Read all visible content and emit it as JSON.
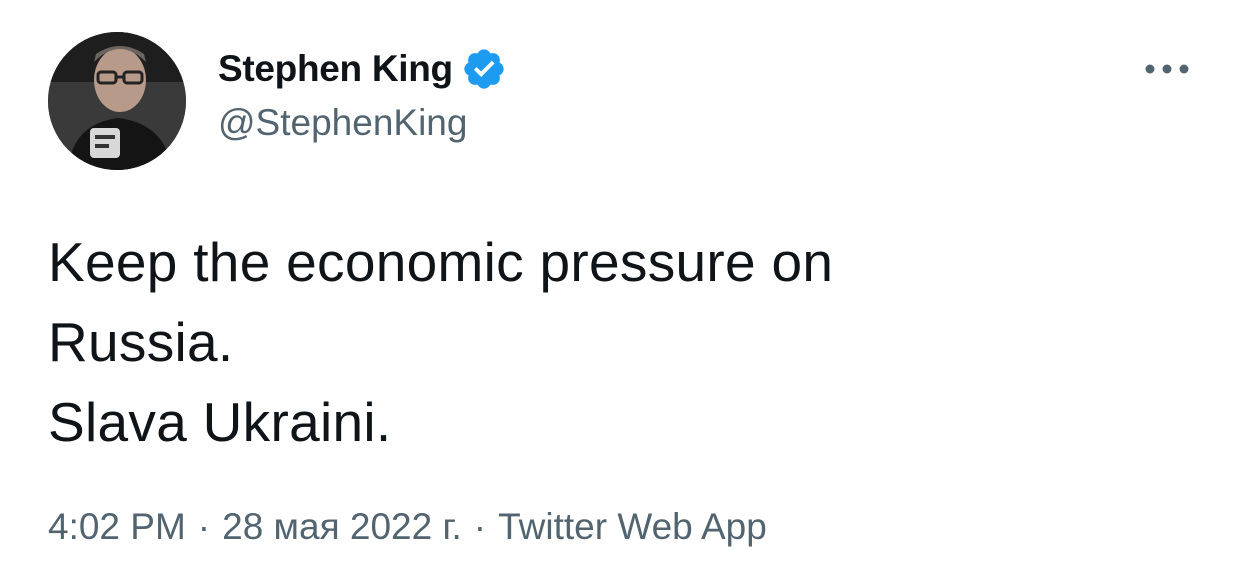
{
  "author": {
    "display_name": "Stephen King",
    "handle": "@StephenKing",
    "verified": true,
    "avatar_icon": "profile-photo",
    "verified_icon": "verified-badge-icon",
    "verified_color": "#1d9bf0"
  },
  "menu": {
    "more_icon": "more-horizontal-icon"
  },
  "tweet": {
    "lines": [
      "Keep the economic pressure on",
      "Russia.",
      "Slava Ukraini."
    ]
  },
  "meta": {
    "time": "4:02 PM",
    "separator": "·",
    "date": "28 мая 2022 г.",
    "source": "Twitter Web App"
  },
  "colors": {
    "text_primary": "#0f1419",
    "text_secondary": "#536471",
    "background": "#ffffff"
  }
}
